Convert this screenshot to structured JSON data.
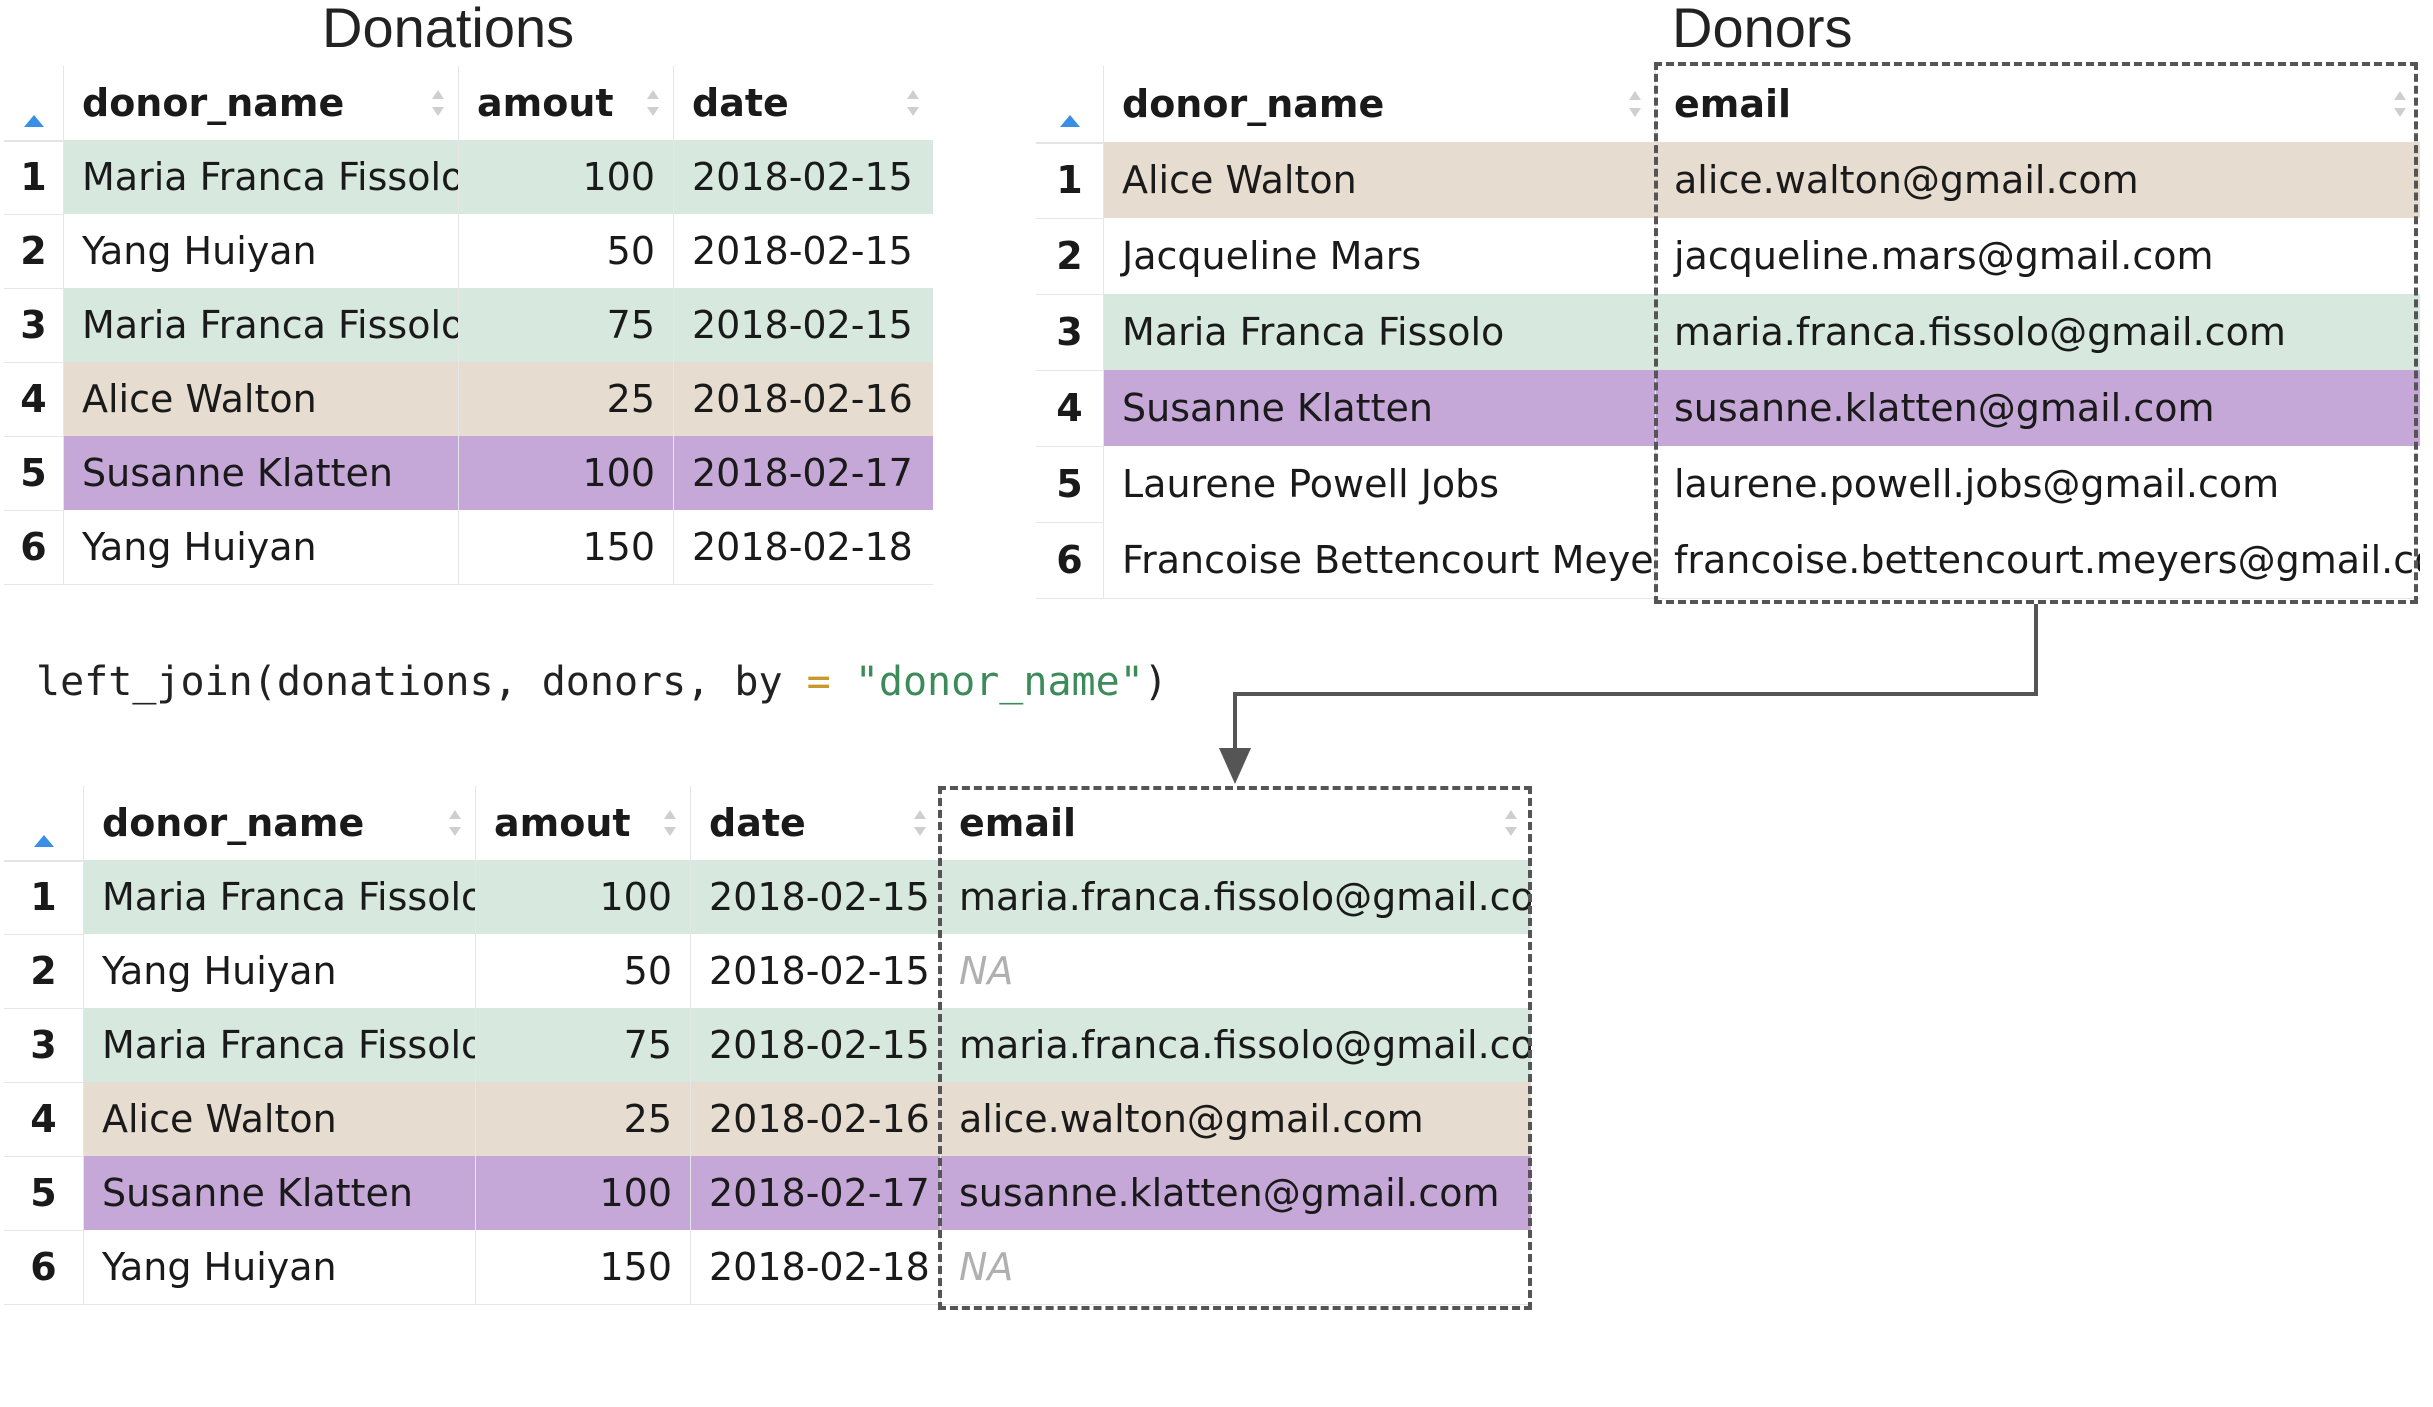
{
  "colors": {
    "green": "#d7e9de",
    "tan": "#e6ddd0",
    "purple": "#c6a8d8",
    "white": "#ffffff"
  },
  "donations": {
    "title": "Donations",
    "columns": [
      "donor_name",
      "amout",
      "date"
    ],
    "rows": [
      {
        "idx": "1",
        "donor_name": "Maria Franca Fissolo",
        "amout": "100",
        "date": "2018-02-15",
        "color": "green"
      },
      {
        "idx": "2",
        "donor_name": "Yang Huiyan",
        "amout": "50",
        "date": "2018-02-15",
        "color": "white"
      },
      {
        "idx": "3",
        "donor_name": "Maria Franca Fissolo",
        "amout": "75",
        "date": "2018-02-15",
        "color": "green"
      },
      {
        "idx": "4",
        "donor_name": "Alice Walton",
        "amout": "25",
        "date": "2018-02-16",
        "color": "tan"
      },
      {
        "idx": "5",
        "donor_name": "Susanne Klatten",
        "amout": "100",
        "date": "2018-02-17",
        "color": "purple"
      },
      {
        "idx": "6",
        "donor_name": "Yang Huiyan",
        "amout": "150",
        "date": "2018-02-18",
        "color": "white"
      }
    ]
  },
  "donors": {
    "title": "Donors",
    "columns": [
      "donor_name",
      "email"
    ],
    "rows": [
      {
        "idx": "1",
        "donor_name": "Alice Walton",
        "email": "alice.walton@gmail.com",
        "color": "tan"
      },
      {
        "idx": "2",
        "donor_name": "Jacqueline Mars",
        "email": "jacqueline.mars@gmail.com",
        "color": "white"
      },
      {
        "idx": "3",
        "donor_name": "Maria Franca Fissolo",
        "email": "maria.franca.fissolo@gmail.com",
        "color": "green"
      },
      {
        "idx": "4",
        "donor_name": "Susanne Klatten",
        "email": "susanne.klatten@gmail.com",
        "color": "purple"
      },
      {
        "idx": "5",
        "donor_name": "Laurene Powell Jobs",
        "email": "laurene.powell.jobs@gmail.com",
        "color": "white"
      },
      {
        "idx": "6",
        "donor_name": "Francoise Bettencourt Meyers",
        "email": "francoise.bettencourt.meyers@gmail.com",
        "color": "white"
      }
    ]
  },
  "code": {
    "func": "left_join(donations, donors, by ",
    "op": "=",
    "space": " ",
    "str": "\"donor_name\"",
    "close": ")"
  },
  "result": {
    "columns": [
      "donor_name",
      "amout",
      "date",
      "email"
    ],
    "rows": [
      {
        "idx": "1",
        "donor_name": "Maria Franca Fissolo",
        "amout": "100",
        "date": "2018-02-15",
        "email": "maria.franca.fissolo@gmail.com",
        "color": "green"
      },
      {
        "idx": "2",
        "donor_name": "Yang Huiyan",
        "amout": "50",
        "date": "2018-02-15",
        "email": "NA",
        "color": "white"
      },
      {
        "idx": "3",
        "donor_name": "Maria Franca Fissolo",
        "amout": "75",
        "date": "2018-02-15",
        "email": "maria.franca.fissolo@gmail.com",
        "color": "green"
      },
      {
        "idx": "4",
        "donor_name": "Alice Walton",
        "amout": "25",
        "date": "2018-02-16",
        "email": "alice.walton@gmail.com",
        "color": "tan"
      },
      {
        "idx": "5",
        "donor_name": "Susanne Klatten",
        "amout": "100",
        "date": "2018-02-17",
        "email": "susanne.klatten@gmail.com",
        "color": "purple"
      },
      {
        "idx": "6",
        "donor_name": "Yang Huiyan",
        "amout": "150",
        "date": "2018-02-18",
        "email": "NA",
        "color": "white"
      }
    ]
  }
}
